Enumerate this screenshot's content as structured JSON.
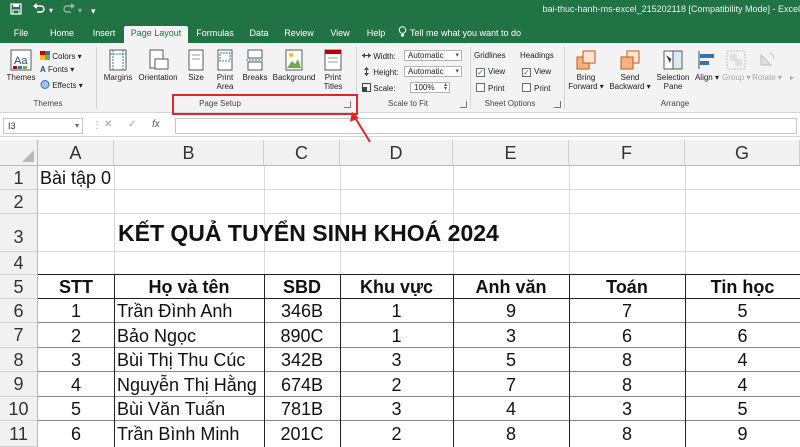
{
  "titlebar": {
    "title": "bai-thuc-hanh-ms-excel_215202118  [Compatibility Mode]  -  Excel"
  },
  "tabs": [
    {
      "label": "File"
    },
    {
      "label": "Home"
    },
    {
      "label": "Insert"
    },
    {
      "label": "Page Layout",
      "active": true
    },
    {
      "label": "Formulas"
    },
    {
      "label": "Data"
    },
    {
      "label": "Review"
    },
    {
      "label": "View"
    },
    {
      "label": "Help"
    }
  ],
  "tell_me": "Tell me what you want to do",
  "ribbon": {
    "themes": {
      "themes": "Themes",
      "colors": "Colors",
      "fonts": "Fonts",
      "effects": "Effects",
      "group": "Themes"
    },
    "page_setup": {
      "margins": "Margins",
      "orientation": "Orientation",
      "size": "Size",
      "print_area_1": "Print",
      "print_area_2": "Area",
      "breaks": "Breaks",
      "background": "Background",
      "print_titles_1": "Print",
      "print_titles_2": "Titles",
      "group": "Page Setup"
    },
    "scale_to_fit": {
      "width_label": "Width:",
      "width_value": "Automatic",
      "height_label": "Height:",
      "height_value": "Automatic",
      "scale_label": "Scale:",
      "scale_value": "100%",
      "group": "Scale to Fit"
    },
    "sheet_options": {
      "gridlines": "Gridlines",
      "headings": "Headings",
      "view": "View",
      "print": "Print",
      "group": "Sheet Options"
    },
    "arrange": {
      "bring_forward_1": "Bring",
      "bring_forward_2": "Forward",
      "send_backward_1": "Send",
      "send_backward_2": "Backward",
      "selection_pane_1": "Selection",
      "selection_pane_2": "Pane",
      "align": "Align",
      "group_btn": "Group",
      "rotate": "Rotate",
      "group": "Arrange"
    }
  },
  "formula_bar": {
    "name_box": "I3",
    "cancel": "✕",
    "enter": "✓",
    "fx": "fx"
  },
  "sheet": {
    "columns": [
      "A",
      "B",
      "C",
      "D",
      "E",
      "F",
      "G"
    ],
    "rows": [
      "1",
      "2",
      "3",
      "4",
      "5",
      "6",
      "7",
      "8",
      "9",
      "10",
      "11"
    ],
    "a1": "Bài tập 0",
    "title": "KẾT QUẢ TUYỂN SINH KHOÁ 2024",
    "headers": [
      "STT",
      "Họ và tên",
      "SBD",
      "Khu vực",
      "Anh văn",
      "Toán",
      "Tin học"
    ],
    "data": [
      [
        "1",
        "Trần Đình Anh",
        "346B",
        "1",
        "9",
        "7",
        "5"
      ],
      [
        "2",
        "Bảo Ngọc",
        "890C",
        "1",
        "3",
        "6",
        "6"
      ],
      [
        "3",
        "Bùi Thị Thu Cúc",
        "342B",
        "3",
        "5",
        "8",
        "4"
      ],
      [
        "4",
        "Nguyễn Thị Hằng",
        "674B",
        "2",
        "7",
        "8",
        "4"
      ],
      [
        "5",
        "Bùi Văn Tuấn",
        "781B",
        "3",
        "4",
        "3",
        "5"
      ],
      [
        "6",
        "Trần Bình Minh",
        "201C",
        "2",
        "8",
        "8",
        "9"
      ]
    ]
  },
  "colors": {
    "accent": "#217346",
    "annotation": "#e1262b"
  }
}
